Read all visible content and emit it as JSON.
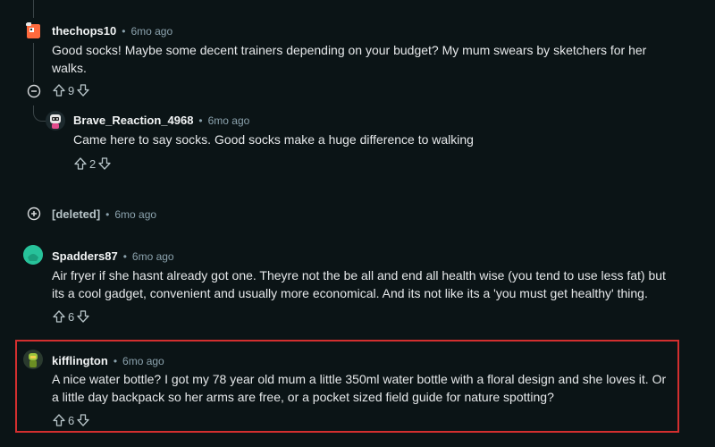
{
  "comments": [
    {
      "author": "thechops10",
      "separator": "•",
      "time": "6mo ago",
      "text_line1": "Good socks! Maybe some decent trainers depending on your budget? My mum swears by sketchers for her",
      "text_line2": "walks.",
      "votes": "9"
    },
    {
      "author": "Brave_Reaction_4968",
      "separator": "•",
      "time": "6mo ago",
      "text_line1": "Came here to say socks. Good socks make a huge difference to walking",
      "votes": "2"
    },
    {
      "author": "[deleted]",
      "separator": "•",
      "time": "6mo ago"
    },
    {
      "author": "Spadders87",
      "separator": "•",
      "time": "6mo ago",
      "text_line1": "Air fryer if she hasnt already got one. Theyre not the be all and end all health wise (you tend to use less fat) but",
      "text_line2": "its a cool gadget, convenient and usually more economical. And its not like its a 'you must get healthy' thing.",
      "votes": "6"
    },
    {
      "author": "kifflington",
      "separator": "•",
      "time": "6mo ago",
      "text_line1": "A nice water bottle? I got my 78 year old mum a little 350ml water bottle with a floral design and she loves it. Or",
      "text_line2": "a little day backpack so her arms are free, or a pocket sized field guide for nature spotting?",
      "votes": "6"
    }
  ],
  "colors": {
    "background": "#0b1416",
    "highlight_border": "#d32f2f",
    "thread_line": "#3a4447"
  },
  "icons": [
    "upvote-icon",
    "downvote-icon",
    "collapse-icon",
    "expand-icon"
  ]
}
